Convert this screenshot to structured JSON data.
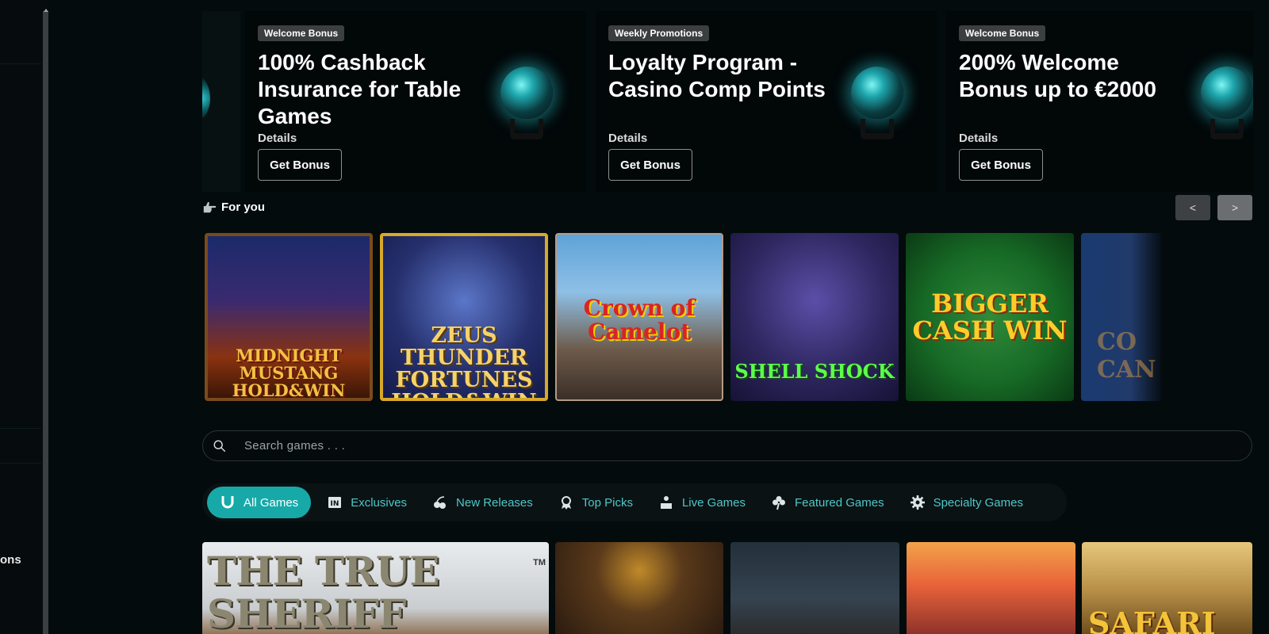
{
  "sidebar": {
    "partial_label": "ons"
  },
  "promos": [
    {
      "tag": "Welcome Bonus",
      "title": "100% Cashback Insurance for Table Games",
      "details": "Details",
      "button": "Get Bonus"
    },
    {
      "tag": "Weekly Promotions",
      "title": "Loyalty Program - Casino Comp Points",
      "details": "Details",
      "button": "Get Bonus"
    },
    {
      "tag": "Welcome Bonus",
      "title": "200% Welcome Bonus up to €2000",
      "details": "Details",
      "button": "Get Bonus"
    }
  ],
  "for_you": {
    "label": "For you",
    "icon": "pointing-hand-icon",
    "prev": "<",
    "next": ">"
  },
  "carousel_games": [
    {
      "title": "MIDNIGHT MUSTANG HOLD&WIN"
    },
    {
      "title": "ZEUS THUNDER FORTUNES HOLD&WIN"
    },
    {
      "title": "Crown of Camelot"
    },
    {
      "title": "SHELL SHOCK"
    },
    {
      "title": "BIGGER CASH WIN"
    },
    {
      "title": "CO CAN"
    }
  ],
  "search": {
    "placeholder": "Search games . . ."
  },
  "tabs": [
    {
      "label": "All Games",
      "icon": "horseshoe-icon",
      "active": true
    },
    {
      "label": "Exclusives",
      "icon": "exclusive-badge-icon"
    },
    {
      "label": "New Releases",
      "icon": "cherries-icon"
    },
    {
      "label": "Top Picks",
      "icon": "award-ribbon-icon"
    },
    {
      "label": "Live Games",
      "icon": "dealer-icon"
    },
    {
      "label": "Featured Games",
      "icon": "clover-icon"
    },
    {
      "label": "Specialty Games",
      "icon": "gear-icon"
    }
  ],
  "grid_games": [
    {
      "title": "THE TRUE SHERIFF",
      "tm": "TM"
    },
    {
      "title": ""
    },
    {
      "title": ""
    },
    {
      "title": ""
    },
    {
      "title": "SAFARI"
    }
  ],
  "colors": {
    "background": "#040b0c",
    "accent": "#17a9a8",
    "tab_text": "#4fc7c8",
    "tag_bg": "#3b3f40"
  }
}
